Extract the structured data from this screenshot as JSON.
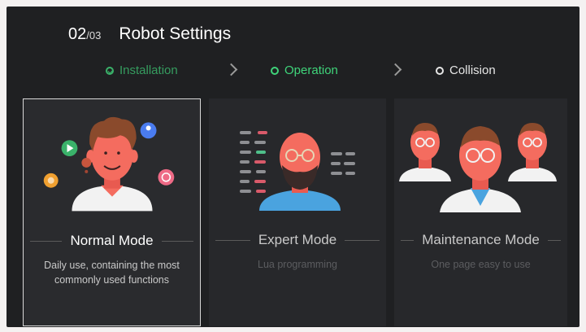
{
  "header": {
    "step_current": "02",
    "step_total": "/03",
    "title": "Robot Settings"
  },
  "stepper": [
    {
      "label": "Installation",
      "state": "done"
    },
    {
      "label": "Operation",
      "state": "active"
    },
    {
      "label": "Collision",
      "state": "pending"
    }
  ],
  "modes": [
    {
      "title": "Normal Mode",
      "description": "Daily use, containing the most commonly used functions",
      "selected": true
    },
    {
      "title": "Expert Mode",
      "description": "Lua programming",
      "selected": false
    },
    {
      "title": "Maintenance Mode",
      "description": "One page easy to use",
      "selected": false
    }
  ],
  "colors": {
    "accent_green": "#3fd47a",
    "background": "#1f2022",
    "card": "#27282b",
    "skin": "#f46c5f",
    "shirt_blue": "#4aa3df"
  }
}
